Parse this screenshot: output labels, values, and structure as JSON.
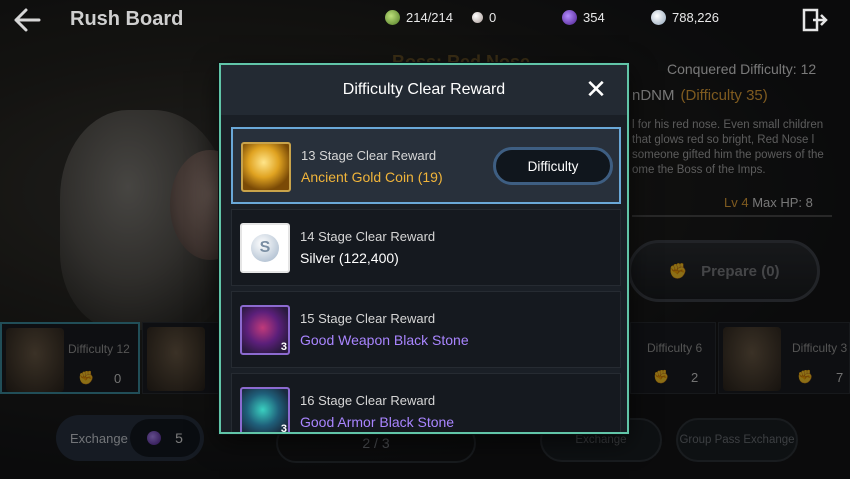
{
  "header": {
    "title": "Rush Board",
    "resources": [
      {
        "icon": "energy-icon",
        "value": "214/214"
      },
      {
        "icon": "pearl-icon",
        "value": "0"
      },
      {
        "icon": "black-stone-icon",
        "value": "354"
      },
      {
        "icon": "silver-icon",
        "value": "788,226"
      }
    ]
  },
  "boss": {
    "title": "Boss: Red Nose",
    "conquered": "Conquered Difficulty: 12",
    "name": "nDNM",
    "difficulty": "(Difficulty 35)",
    "description": "l for his red nose. Even small children that glows red so bright, Red Nose l someone gifted him the powers of the ome the Boss of the Imps.",
    "level": "Lv 4",
    "max_hp": "Max HP: 8",
    "prepare_label": "Prepare (0)"
  },
  "difficulty_cards": [
    {
      "label": "Difficulty 12",
      "count": "0"
    },
    {
      "label": "Difficulty 6",
      "count": "2"
    },
    {
      "label": "Difficulty 3",
      "count": "7"
    }
  ],
  "bottom": {
    "exchange_label": "Exchange",
    "exchange_count": "5",
    "pager": "2 / 3",
    "exchange_btn": "Exchange",
    "group_pass_exchange": "Group Pass Exchange"
  },
  "modal": {
    "title": "Difficulty Clear Reward",
    "close": "✕",
    "rows": [
      {
        "stage": "13 Stage Clear Reward",
        "item": "Ancient Gold Coin (19)",
        "button": "Difficulty"
      },
      {
        "stage": "14 Stage Clear Reward",
        "item": "Silver (122,400)",
        "coin_letter": "S"
      },
      {
        "stage": "15 Stage Clear Reward",
        "item": "Good Weapon Black Stone",
        "qty": "3"
      },
      {
        "stage": "16 Stage Clear Reward",
        "item": "Good Armor Black Stone",
        "qty": "3"
      }
    ]
  },
  "colors": {
    "accent_gold": "#f0b43a",
    "accent_purple": "#a985ff",
    "modal_border": "#61c5a8"
  }
}
